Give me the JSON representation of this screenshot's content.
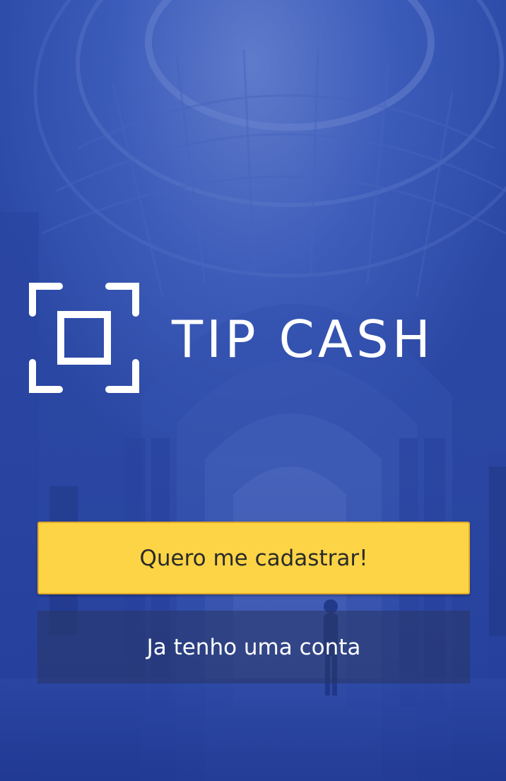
{
  "app": {
    "title": "TIP CASH"
  },
  "actions": {
    "register_label": "Quero me cadastrar!",
    "login_label": "Ja tenho uma conta"
  },
  "icons": {
    "logo": "scan-frame-icon"
  },
  "colors": {
    "background_blue": "#2f4fa8",
    "primary_button": "#fdd445",
    "primary_button_border": "#e0a92a",
    "primary_button_text": "#2a2a2a",
    "secondary_button_text": "#ffffff",
    "brand_text": "#ffffff"
  }
}
